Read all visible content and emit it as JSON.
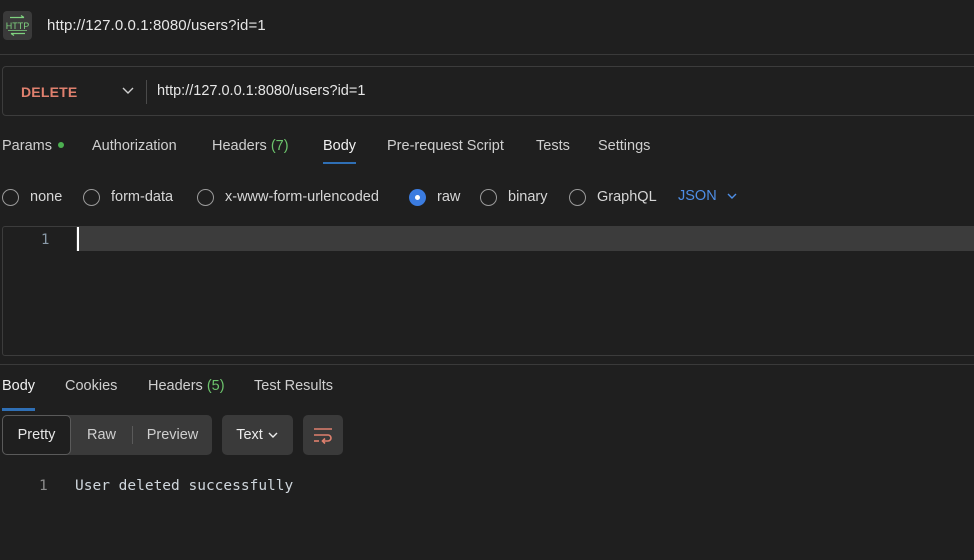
{
  "title_bar": {
    "icon": "http-icon",
    "title": "http://127.0.0.1:8080/users?id=1"
  },
  "request": {
    "method": "DELETE",
    "method_color": "#e0806e",
    "url": "http://127.0.0.1:8080/users?id=1"
  },
  "request_tabs": [
    {
      "label": "Params",
      "indicator": "dot",
      "active": false
    },
    {
      "label": "Authorization",
      "active": false
    },
    {
      "label": "Headers",
      "count": "(7)",
      "active": false
    },
    {
      "label": "Body",
      "active": true
    },
    {
      "label": "Pre-request Script",
      "active": false
    },
    {
      "label": "Tests",
      "active": false
    },
    {
      "label": "Settings",
      "active": false
    }
  ],
  "body_types": [
    {
      "label": "none",
      "checked": false
    },
    {
      "label": "form-data",
      "checked": false
    },
    {
      "label": "x-www-form-urlencoded",
      "checked": false
    },
    {
      "label": "raw",
      "checked": true
    },
    {
      "label": "binary",
      "checked": false
    },
    {
      "label": "GraphQL",
      "checked": false
    }
  ],
  "raw_format": "JSON",
  "editor": {
    "lines": [
      {
        "number": "1",
        "text": ""
      }
    ]
  },
  "response_tabs": [
    {
      "label": "Body",
      "active": true
    },
    {
      "label": "Cookies",
      "active": false
    },
    {
      "label": "Headers",
      "count": "(5)",
      "active": false
    },
    {
      "label": "Test Results",
      "active": false
    }
  ],
  "response_view": {
    "modes": [
      "Pretty",
      "Raw",
      "Preview"
    ],
    "active_mode": "Pretty",
    "format": "Text",
    "wrap_icon": "wrap-lines-icon"
  },
  "response_body": {
    "lines": [
      {
        "number": "1",
        "text": "User deleted successfully"
      }
    ]
  },
  "colors": {
    "accent_blue": "#3b7ce0",
    "tab_underline": "#2f6fb5",
    "count_green": "#6cc36c",
    "params_dot": "#4caf50",
    "wrap_icon": "#e0806e",
    "background": "#1f1f1f"
  }
}
